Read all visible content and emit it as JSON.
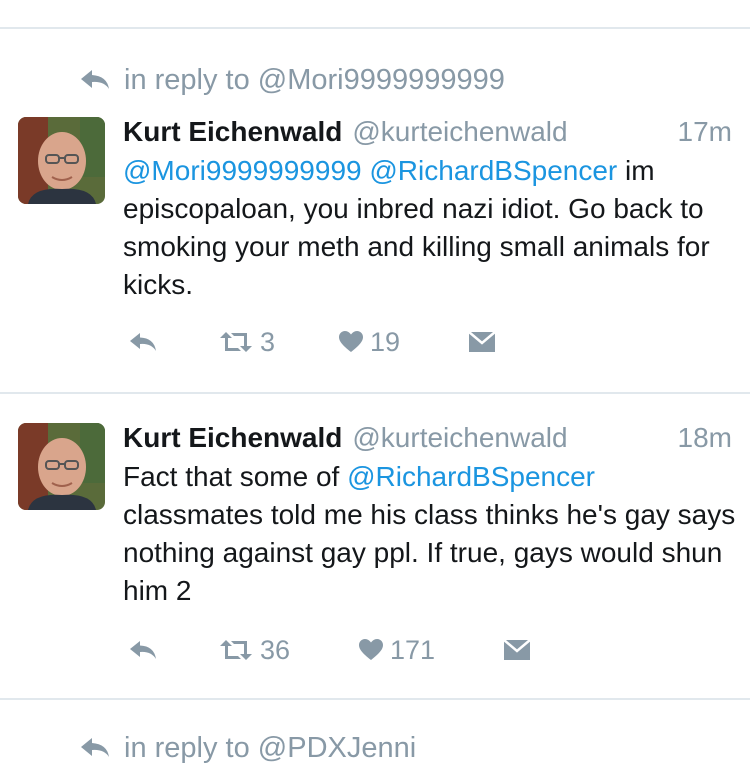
{
  "top_context": {
    "label": "in reply to @Mori9999999999"
  },
  "tweets": [
    {
      "name": "Kurt Eichenwald",
      "handle": "@kurteichenwald",
      "time": "17m",
      "mention1": "@Mori9999999999",
      "mention2": "@RichardBSpencer",
      "text_after": " im episcopaloan, you inbred nazi idiot. Go back to smoking your meth and killing small animals for kicks.",
      "retweets": "3",
      "likes": "19"
    },
    {
      "name": "Kurt Eichenwald",
      "handle": "@kurteichenwald",
      "time": "18m",
      "text_before": "Fact that some of ",
      "mention1": "@RichardBSpencer",
      "text_after": "\nclassmates told me his class thinks he's gay says nothing against gay ppl. If true, gays would shun him 2",
      "retweets": "36",
      "likes": "171"
    }
  ],
  "bottom_context": {
    "label": "in reply to @PDXJenni"
  },
  "colors": {
    "link": "#1b95e0",
    "muted": "#8899a6",
    "text": "#14171a",
    "divider": "#e1e8ed"
  },
  "icons": {
    "reply": "reply-arrow",
    "retweet": "retweet-arrows",
    "like": "heart",
    "dm": "envelope"
  }
}
